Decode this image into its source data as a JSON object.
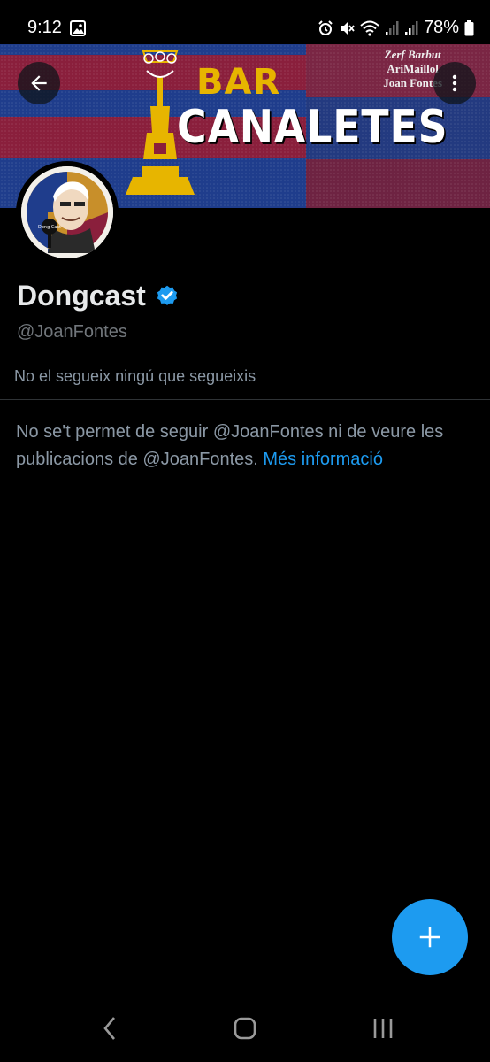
{
  "status_bar": {
    "time": "9:12",
    "battery": "78%",
    "icons": [
      "gallery-icon",
      "alarm-icon",
      "mute-icon",
      "wifi-icon",
      "signal-icon",
      "signal-icon",
      "battery-icon"
    ]
  },
  "banner": {
    "line1": "BAR",
    "line2": "CANALETES",
    "credits": [
      "Zerf Barbut",
      "AriMaillol",
      "Joan Fontes"
    ],
    "colors": {
      "blue": "#1f3d8c",
      "garnet": "#8a1f3c",
      "gold": "#e7b500"
    }
  },
  "profile": {
    "name": "Dongcast",
    "handle": "@JoanFontes",
    "verified": true,
    "followed_by": "No el segueix ningú que segueixis",
    "blocked_message": "No se't permet de seguir @JoanFontes ni de veure les publicacions de @JoanFontes.",
    "more_info_link": "Més informació",
    "avatar_caption": "Dong Cast"
  },
  "actions": {
    "back": "arrow-left-icon",
    "more": "more-vertical-icon",
    "compose": "plus-icon"
  },
  "colors": {
    "accent": "#1d9bf0",
    "background": "#000000",
    "text": "#e7e9ea",
    "muted": "#71767b"
  }
}
